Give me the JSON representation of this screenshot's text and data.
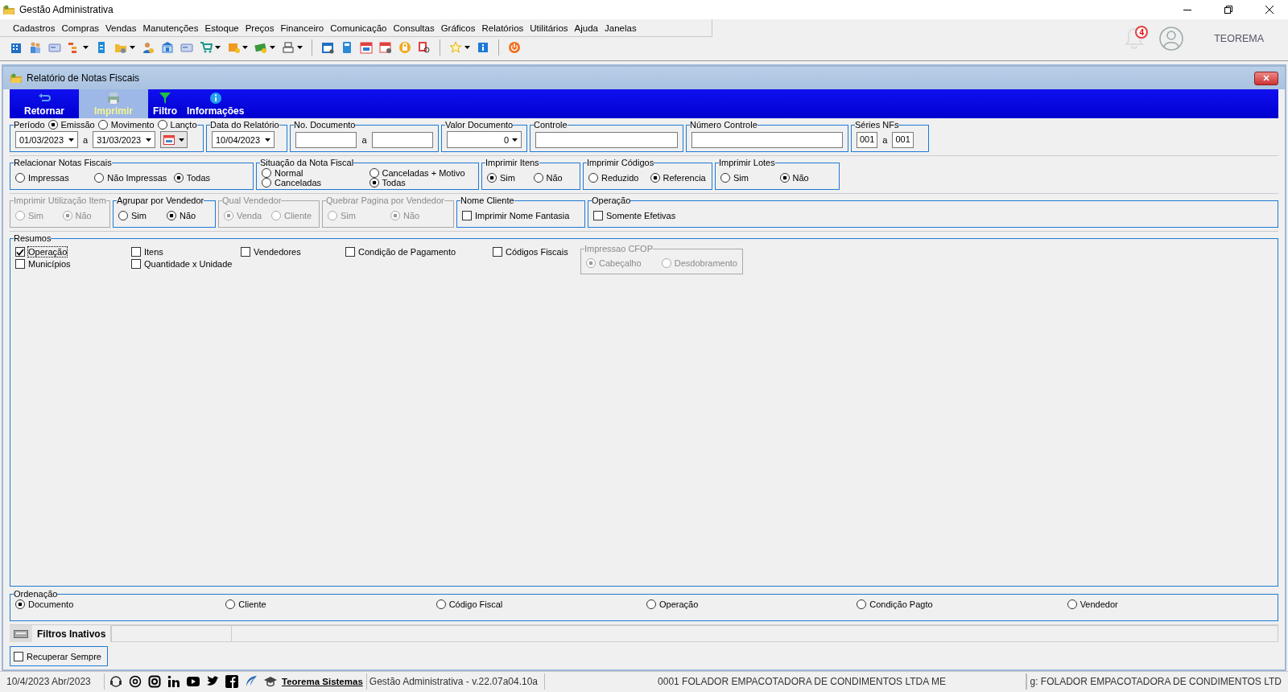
{
  "app": {
    "title": "Gestão Administrativa",
    "menu": [
      "Cadastros",
      "Compras",
      "Vendas",
      "Manutenções",
      "Estoque",
      "Preços",
      "Financeiro",
      "Comunicação",
      "Consultas",
      "Gráficos",
      "Relatórios",
      "Utilitários",
      "Ajuda",
      "Janelas"
    ],
    "notifications": "4",
    "user": "TEOREMA"
  },
  "window": {
    "title": "Relatório de Notas Fiscais",
    "actions": [
      {
        "label": "Retornar",
        "kind": "return",
        "hovered": false
      },
      {
        "label": "Imprimir",
        "kind": "print",
        "hovered": true
      },
      {
        "label": "Filtro",
        "kind": "filter",
        "hovered": false
      },
      {
        "label": "Informações",
        "kind": "info",
        "hovered": false
      }
    ]
  },
  "rows": [
    [
      {
        "title": "Período",
        "disabled": false,
        "kind": "row",
        "header": [
          {
            "kind": "radio",
            "label": "Emissão",
            "selected": true
          },
          {
            "kind": "radio",
            "label": "Movimento",
            "selected": false
          },
          {
            "kind": "radio",
            "label": "Lançto",
            "selected": false
          }
        ],
        "items": [
          {
            "kind": "date",
            "value": "01/03/2023"
          },
          {
            "kind": "text",
            "label": "a"
          },
          {
            "kind": "date",
            "value": "31/03/2023"
          },
          {
            "kind": "calendar"
          }
        ]
      },
      {
        "title": "Data do Relatório",
        "disabled": false,
        "kind": "row",
        "items": [
          {
            "kind": "date",
            "value": "10/04/2023"
          }
        ]
      },
      {
        "title": "No. Documento",
        "disabled": false,
        "kind": "row",
        "items": [
          {
            "kind": "input"
          },
          {
            "kind": "text",
            "label": "a"
          },
          {
            "kind": "input"
          }
        ]
      },
      {
        "title": "Valor Documento",
        "disabled": false,
        "kind": "row",
        "items": [
          {
            "kind": "combo",
            "value": "0"
          }
        ]
      },
      {
        "title": "Controle",
        "disabled": false,
        "kind": "row",
        "items": [
          {
            "kind": "input"
          }
        ]
      },
      {
        "title": "Número Controle",
        "disabled": false,
        "kind": "row",
        "items": [
          {
            "kind": "input"
          }
        ]
      },
      {
        "title": "Séries NFs",
        "disabled": false,
        "kind": "row",
        "items": [
          {
            "kind": "code",
            "value": "001"
          },
          {
            "kind": "text",
            "label": "a"
          },
          {
            "kind": "code",
            "value": "001"
          }
        ]
      }
    ],
    [
      {
        "title": "Relacionar Notas Fiscais",
        "disabled": false,
        "kind": "row",
        "items": [
          {
            "kind": "radio",
            "label": "Impressas",
            "selected": false
          },
          {
            "kind": "radio",
            "label": "Não Impressas",
            "selected": false
          },
          {
            "kind": "radio",
            "label": "Todas",
            "selected": true
          }
        ]
      },
      {
        "title": "Situação da Nota Fiscal",
        "disabled": false,
        "kind": "grid",
        "items": [
          {
            "kind": "radio",
            "label": "Normal",
            "selected": false
          },
          {
            "kind": "radio",
            "label": "Canceladas + Motivo",
            "selected": false
          },
          {
            "kind": "radio",
            "label": "Canceladas",
            "selected": false
          },
          {
            "kind": "radio",
            "label": "Todas",
            "selected": true
          }
        ]
      },
      {
        "title": "Imprimir Itens",
        "disabled": false,
        "kind": "row",
        "items": [
          {
            "kind": "radio",
            "label": "Sim",
            "selected": true
          },
          {
            "kind": "radio",
            "label": "Não",
            "selected": false
          }
        ]
      },
      {
        "title": "Imprimir Códigos",
        "disabled": false,
        "kind": "row",
        "items": [
          {
            "kind": "radio",
            "label": "Reduzido",
            "selected": false
          },
          {
            "kind": "radio",
            "label": "Referencia",
            "selected": true
          }
        ]
      },
      {
        "title": "Imprimir Lotes",
        "disabled": false,
        "kind": "row",
        "items": [
          {
            "kind": "radio",
            "label": "Sim",
            "selected": false
          },
          {
            "kind": "radio",
            "label": "Não",
            "selected": true
          }
        ]
      }
    ],
    [
      {
        "title": "Imprimir Utilização Item",
        "disabled": true,
        "kind": "row",
        "items": [
          {
            "kind": "radio",
            "label": "Sim",
            "selected": false
          },
          {
            "kind": "radio",
            "label": "Não",
            "selected": true
          }
        ]
      },
      {
        "title": "Agrupar por Vendedor",
        "disabled": false,
        "kind": "row",
        "items": [
          {
            "kind": "radio",
            "label": "Sim",
            "selected": false
          },
          {
            "kind": "radio",
            "label": "Não",
            "selected": true
          }
        ]
      },
      {
        "title": "Qual Vendedor",
        "disabled": true,
        "kind": "row",
        "items": [
          {
            "kind": "radio",
            "label": "Venda",
            "selected": true
          },
          {
            "kind": "radio",
            "label": "Cliente",
            "selected": false
          }
        ]
      },
      {
        "title": "Quebrar Pagina por Vendedor",
        "disabled": true,
        "kind": "row",
        "items": [
          {
            "kind": "radio",
            "label": "Sim",
            "selected": false
          },
          {
            "kind": "radio",
            "label": "Não",
            "selected": true
          }
        ]
      },
      {
        "title": "Nome Cliente",
        "disabled": false,
        "kind": "row",
        "items": [
          {
            "kind": "check",
            "label": "Imprimir Nome Fantasia",
            "checked": false,
            "focused": false
          }
        ]
      },
      {
        "title": "Operação",
        "disabled": false,
        "kind": "row",
        "items": [
          {
            "kind": "check",
            "label": "Somente Efetivas",
            "checked": false,
            "focused": false
          }
        ]
      }
    ]
  ],
  "resumos": {
    "title": "Resumos",
    "columns": [
      [
        {
          "kind": "check",
          "label": "Operação",
          "checked": true,
          "focused": true
        },
        {
          "kind": "check",
          "label": "Municípios",
          "checked": false,
          "focused": false
        }
      ],
      [
        {
          "kind": "check",
          "label": "Itens",
          "checked": false,
          "focused": false
        },
        {
          "kind": "check",
          "label": "Quantidade x Unidade",
          "checked": false,
          "focused": false
        }
      ],
      [
        {
          "kind": "check",
          "label": "Vendedores",
          "checked": false,
          "focused": false
        }
      ],
      [
        {
          "kind": "check",
          "label": "Condição de Pagamento",
          "checked": false,
          "focused": false
        }
      ],
      [
        {
          "kind": "check",
          "label": "Códigos Fiscais",
          "checked": false,
          "focused": false
        }
      ]
    ],
    "subgroup": {
      "title": "Impressao CFOP",
      "disabled": true,
      "items": [
        {
          "kind": "radio",
          "label": "Cabeçalho",
          "selected": true
        },
        {
          "kind": "radio",
          "label": "Desdobramento",
          "selected": false
        }
      ]
    }
  },
  "ordenacao": {
    "title": "Ordenação",
    "disabled": false,
    "items": [
      {
        "kind": "radio",
        "label": "Documento",
        "selected": true
      },
      {
        "kind": "radio",
        "label": "Cliente",
        "selected": false
      },
      {
        "kind": "radio",
        "label": "Código Fiscal",
        "selected": false
      },
      {
        "kind": "radio",
        "label": "Operação",
        "selected": false
      },
      {
        "kind": "radio",
        "label": "Condição Pagto",
        "selected": false
      },
      {
        "kind": "radio",
        "label": "Vendedor",
        "selected": false
      }
    ]
  },
  "filters": {
    "label": "Filtros Inativos",
    "recover": {
      "kind": "check",
      "label": "Recuperar Sempre",
      "checked": false,
      "focused": false
    }
  },
  "status_bar": {
    "date": "10/4/2023 Abr/2023",
    "link": "Teorema Sistemas",
    "version": "Gestão Administrativa - v.22.07a04.10a",
    "company": "0001 FOLADOR EMPACOTADORA DE CONDIMENTOS LTDA ME",
    "company_2": "g: FOLADOR EMPACOTADORA DE CONDIMENTOS LTD"
  }
}
